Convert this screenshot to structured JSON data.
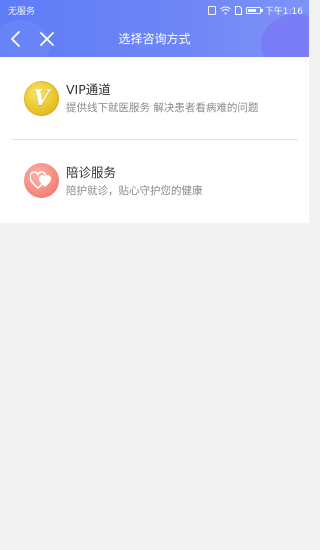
{
  "status_bar": {
    "carrier": "无服务",
    "time": "下午1:16"
  },
  "nav": {
    "title": "选择咨询方式",
    "back_icon": "chevron-left-icon",
    "close_icon": "close-icon"
  },
  "options": [
    {
      "icon": "vip-icon",
      "icon_letter": "V",
      "title": "VIP通道",
      "description": "提供线下就医服务 解决患者看病难的问题"
    },
    {
      "icon": "hearts-icon",
      "title": "陪诊服务",
      "description": "陪护就诊，贴心守护您的健康"
    }
  ],
  "colors": {
    "header_start": "#5e7cf7",
    "header_end": "#7e93f7",
    "vip_gold": "#e9c52c",
    "heart_coral": "#f5887d",
    "background": "#f2f2f2"
  }
}
